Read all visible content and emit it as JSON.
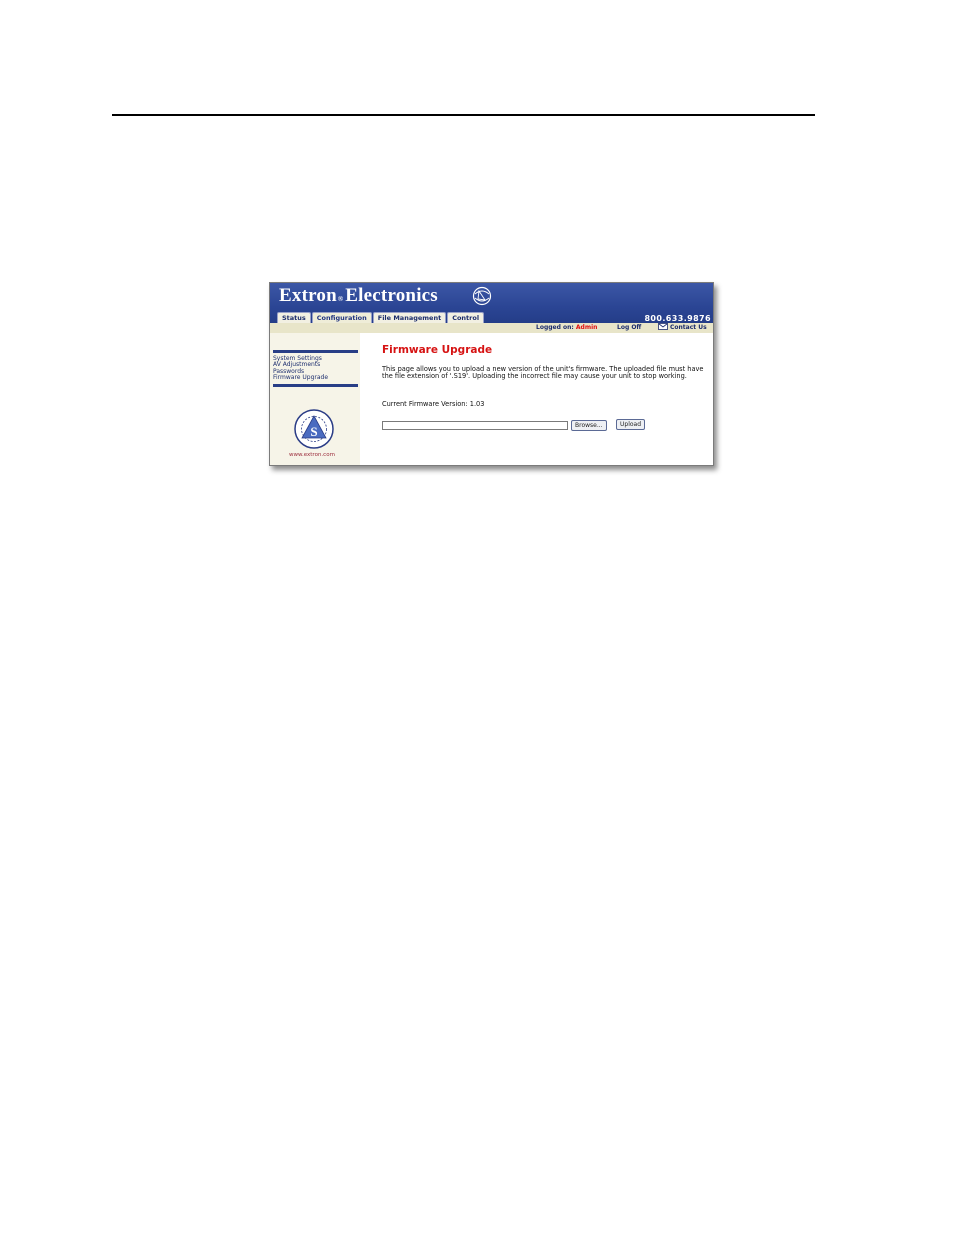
{
  "header": {
    "brand_left": "Extron",
    "brand_reg": "®",
    "brand_right": "Electronics",
    "phone": "800.633.9876"
  },
  "tabs": [
    {
      "label": "Status"
    },
    {
      "label": "Configuration",
      "active": true
    },
    {
      "label": "File Management"
    },
    {
      "label": "Control"
    }
  ],
  "subbar": {
    "logged_label": "Logged on:",
    "user": "Admin",
    "logoff": "Log Off",
    "contact": "Contact Us"
  },
  "sidebar": {
    "items": [
      {
        "label": "System Settings"
      },
      {
        "label": "AV Adjustments"
      },
      {
        "label": "Passwords"
      },
      {
        "label": "Firmware Upgrade"
      }
    ],
    "website": "www.extron.com"
  },
  "main": {
    "title": "Firmware Upgrade",
    "description": "This page allows you to upload a new version of the unit's firmware. The uploaded file must have the file extension of '.S19'. Uploading the incorrect file may cause your unit to stop working.",
    "version_label": "Current Firmware Version:",
    "version_value": "1.03",
    "file_value": "",
    "browse_label": "Browse...",
    "upload_label": "Upload"
  },
  "colors": {
    "banner": "#2b4594",
    "title_red": "#d61313",
    "sidebar_bg": "#f6f4e8",
    "subbar_bg": "#e8e5c9"
  },
  "icons": [
    "globe-icon",
    "envelope-icon",
    "seal-icon"
  ]
}
